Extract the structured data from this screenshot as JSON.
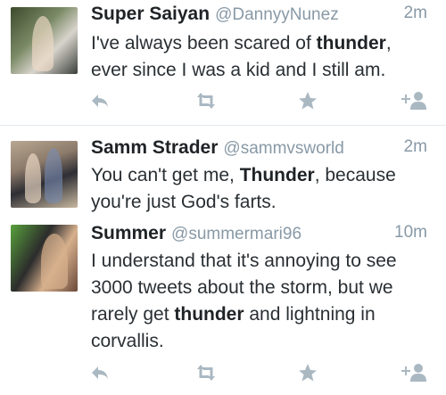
{
  "tweets": [
    {
      "name": "Super Saiyan",
      "handle": "@DannyyNunez",
      "time": "2m",
      "text_parts": [
        "I've always been scared of ",
        "thunder",
        ", ever since I was a kid and I still am."
      ]
    },
    {
      "name": "Samm Strader",
      "handle": "@sammvsworld",
      "time": "2m",
      "text_parts": [
        "You can't get me, ",
        "Thunder",
        ", because you're just God's farts."
      ]
    },
    {
      "name": "Summer",
      "handle": "@summermari96",
      "time": "10m",
      "text_parts": [
        "I understand that it's annoying to see 3000 tweets about the storm, but we rarely get ",
        "thunder",
        " and lightning in corvallis."
      ]
    }
  ],
  "icons": {
    "reply": "reply-icon",
    "retweet": "retweet-icon",
    "favorite": "star-icon",
    "follow": "follow-icon"
  },
  "colors": {
    "icon": "#aab8c2",
    "secondary_text": "#8899a6",
    "divider": "#e1e8ed"
  }
}
